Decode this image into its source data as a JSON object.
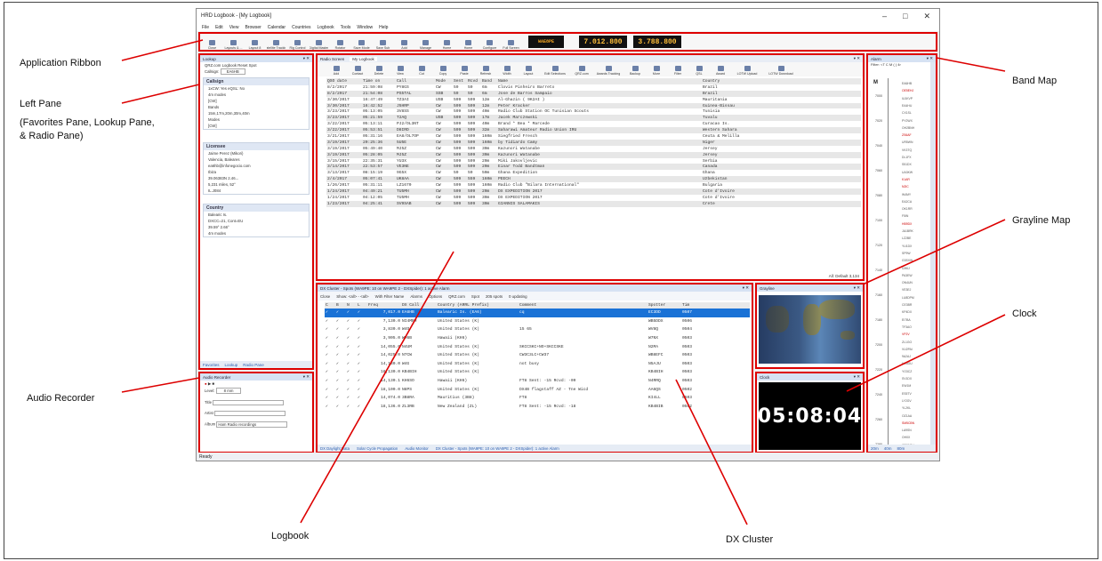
{
  "callouts": {
    "ribbon": "Application Ribbon",
    "left_pane_1": "Left Pane",
    "left_pane_2": "(Favorites Pane, Lookup Pane,",
    "left_pane_3": "& Radio Pane)",
    "audio": "Audio Recorder",
    "logbook": "Logbook",
    "dxcluster": "DX Cluster",
    "clock": "Clock",
    "grayline": "Grayline Map",
    "bandmap": "Band Map"
  },
  "window": {
    "title": "HRD Logbook - [My Logbook]",
    "menu": [
      "File",
      "Edit",
      "View",
      "Browser",
      "Calendar",
      "Countries",
      "Logbook",
      "Tools",
      "Window",
      "Help"
    ]
  },
  "ribbon": {
    "buttons": [
      "Close",
      "Layouts & ...",
      "Layout 8",
      "Satellite Tracking",
      "Rig Control",
      "Digital Master",
      "Rotator",
      "Save Mode",
      "Save Sub",
      "Add",
      "Manage",
      "Home",
      "Home",
      "Configure",
      "Full Screen"
    ],
    "freq_mode": "WAE8PE",
    "freq_vfo_a": "7.012.800",
    "freq_vfo_b": "3.788.800"
  },
  "left_pane": {
    "header": "Lookup",
    "toolbar": "QRZ.com  Logbook  Reset  Spot",
    "callsign_label": "Callsign",
    "callsign_value": "EA6HB",
    "callsign_section": "Callsign",
    "callsign_lines": [
      "1xCW: Yes eQSL: No",
      "4m modes",
      "[CW]",
      "Bands",
      "15m,17m,20m,30m,40m",
      "Modes",
      "[CW]"
    ],
    "licensee_section": "Licensee",
    "licensee_lines": [
      "Jaime Perez (Mikori)",
      "Valencia, Baleares",
      "ea6hb@infonegocio.com",
      "Ibiza",
      "39.06383N 2.46...",
      "5,231 miles, 52°",
      "IL.J084"
    ],
    "country_section": "Country",
    "country_lines": [
      "Balearic Is.",
      "DXCC=21, Cont=EU",
      "39.59° 2.66°",
      "4m modes"
    ],
    "tabs": [
      "Favorites",
      "Lookup",
      "Radio Pane"
    ]
  },
  "audio": {
    "header": "Audio Recorder",
    "level_label": "Level",
    "level_value": "8 mm",
    "title_label": "Title",
    "artist_label": "Artist",
    "album_label": "Album",
    "album_value": "Ham Radio recordings"
  },
  "logbook": {
    "tabs": [
      "Radio Screen",
      "My Logbook"
    ],
    "tools": [
      "Add",
      "Contact",
      "Delete",
      "View",
      "Cut",
      "Copy",
      "Paste",
      "Refresh",
      "Width",
      "Layout",
      "Edit Selections",
      "QRZ.com",
      "Awards Tracking",
      "Backup",
      "More",
      "Filter",
      "QSL",
      "Award",
      "LOTW Upload",
      "LOTW Download"
    ],
    "columns": [
      "QSO date",
      "Time on",
      "Call",
      "Mode",
      "Sent",
      "Rcvd",
      "Band",
      "Name",
      "Country"
    ],
    "rows": [
      [
        "8/2/2017",
        "21:59:08",
        "PY8GS",
        "CW",
        "59",
        "59",
        "6m",
        "Clovis Pinheiro Barreto",
        "Brazil"
      ],
      [
        "8/2/2017",
        "21:54:08",
        "PS5TAL",
        "SSB",
        "59",
        "59",
        "6m",
        "Jose de Barros Sampaio",
        "Brazil"
      ],
      [
        "3/30/2017",
        "16:47:49",
        "TZ3AI",
        "USB",
        "599",
        "599",
        "12m",
        "Al-Ghazin ( 9K2AI )",
        "Mauritania"
      ],
      [
        "3/30/2017",
        "16:42:52",
        "J5HRP",
        "CW",
        "599",
        "599",
        "12m",
        "Peter Kracker",
        "Guinea-Bissau"
      ],
      [
        "3/23/2017",
        "05:13:05",
        "3V8SS",
        "CW",
        "599",
        "599",
        "40m",
        "Radio Club Station OC Tunisian Scouts",
        "Tunisia"
      ],
      [
        "3/23/2017",
        "05:21:59",
        "T2AQ",
        "USB",
        "599",
        "599",
        "17m",
        "Jacek Marczewski",
        "Tuvalu"
      ],
      [
        "3/22/2017",
        "05:13:11",
        "PJ2/OL3NT",
        "CW",
        "599",
        "599",
        "40m",
        "Brand * Bea * Marcede",
        "Curacao Is."
      ],
      [
        "3/22/2017",
        "05:53:51",
        "D8IRD",
        "CW",
        "599",
        "599",
        "32m",
        "Saharawi Amateur Radio Union IRU",
        "Western Sahara"
      ],
      [
        "3/21/2017",
        "05:31:16",
        "EA8/OL7OP",
        "CW",
        "599",
        "599",
        "160m",
        "Siegfried Fresch",
        "Ceuta & Melilla"
      ],
      [
        "3/19/2017",
        "20:25:36",
        "5U5E",
        "CW",
        "599",
        "599",
        "160m",
        "by Tidiardo Camy",
        "Niger"
      ],
      [
        "3/19/2017",
        "05:49:40",
        "MJ5Z",
        "CW",
        "599",
        "599",
        "30m",
        "Kazunori Watanabe",
        "Jersey"
      ],
      [
        "3/19/2017",
        "05:28:05",
        "MJ5Z",
        "CW",
        "599",
        "599",
        "30m",
        "Kazunori Watanabe",
        "Jersey"
      ],
      [
        "3/15/2017",
        "22:35:31",
        "YU3X",
        "CW",
        "599",
        "599",
        "20m",
        "Miki Jakovljevic",
        "Serbia"
      ],
      [
        "3/14/2017",
        "22:53:57",
        "VE3NE",
        "CW",
        "599",
        "599",
        "20m",
        "Einar Todd Bandtman",
        "Canada"
      ],
      [
        "3/13/2017",
        "08:15:19",
        "9G5X",
        "CW",
        "59",
        "59",
        "50m",
        "Ghana Expedition",
        "Ghana"
      ],
      [
        "2/4/2017",
        "05:07:41",
        "UK8AA",
        "CW",
        "599",
        "559",
        "160m",
        "PEECH",
        "Uzbekistan"
      ],
      [
        "1/26/2017",
        "05:31:11",
        "LZ1670",
        "CW",
        "599",
        "599",
        "160m",
        "Radio Club \"Bilara International\"",
        "Bulgaria"
      ],
      [
        "1/24/2017",
        "04:49:21",
        "TU5MH",
        "CW",
        "599",
        "599",
        "20m",
        "DX EXPEDITION 2017",
        "Cote d'Ivoire"
      ],
      [
        "1/24/2017",
        "04:12:05",
        "TU5MH",
        "CW",
        "599",
        "599",
        "30m",
        "DX EXPEDITION 2017",
        "Cote d'Ivoire"
      ],
      [
        "1/23/2017",
        "04:25:41",
        "SV9SAB",
        "CW",
        "599",
        "599",
        "30m",
        "GIANNIS SALAMAKIS",
        "Crete"
      ]
    ],
    "footer": "All: Default   3,134"
  },
  "dxcluster": {
    "header": "DX Cluster - Spots (WA9PE: 10 on WA9PE 2 - DXSpider): 1 active Alarm",
    "toolbar": [
      "Close",
      "Show: <all> - <all>",
      "With Filter Name",
      "Alarms",
      "Options",
      "QRZ.com",
      "Spot",
      "205 spots",
      "0 updating"
    ],
    "columns": [
      "C",
      "B",
      "N",
      "L",
      "Freq",
      "DX Call",
      "Country (ARRL Prefix)",
      "Comment",
      "Spotter",
      "Tim"
    ],
    "rows": [
      [
        "7,017.0",
        "EA6HB",
        "Balearic Is. (EA6)",
        "cq",
        "EC3DD",
        "0507"
      ],
      [
        "7,130.0",
        "NI4MBR",
        "United States (K)",
        "",
        "WB5DDX",
        "0506"
      ],
      [
        "3,830.0",
        "W4O",
        "United States (K)",
        "15 65",
        "WV8Q",
        "0504"
      ],
      [
        "3,905.0",
        "WH6B",
        "Hawaii (KH6)",
        "",
        "W7NX",
        "0503"
      ],
      [
        "14,055.0",
        "N4UM",
        "United States (K)",
        "SKCCSKC+NO+SKCCSKE",
        "N2MA",
        "0503"
      ],
      [
        "14,025.0",
        "N7CW",
        "United States (K)",
        "CW3C3LC+CW37",
        "WB8EFC",
        "0503"
      ],
      [
        "14,130.0",
        "W4G",
        "United States (K)",
        "not busy",
        "N5AJU",
        "0503"
      ],
      [
        "18,130.0",
        "KB4BIH",
        "United States (K)",
        "",
        "KB4BIH",
        "0503"
      ],
      [
        "14,130.1",
        "KH6SO",
        "Hawaii (KH6)",
        "FT8  Sent: -15  Rcvd: -09",
        "N4RRQ",
        "0503"
      ],
      [
        "18,100.0",
        "N8PS",
        "United States (K)",
        "DX4B flagstaff AZ - Tne Wicd",
        "AA6QS",
        "0502"
      ],
      [
        "14,074.0",
        "3B8RA",
        "Mauritius (3B8)",
        "FT8",
        "KI4LL",
        "0503"
      ],
      [
        "18,136.0",
        "ZL3RB",
        "New Zealand (ZL)",
        "FT8  Sent: -15  Rcvd: -18",
        "KB4BIB",
        "0502"
      ]
    ],
    "tabs": [
      "DX Daylight Data",
      "Solar Cycle Propagation",
      "Audio Monitor",
      "DX Cluster - Spots (WA9PE: 10 on WA9PE 2 - DXSpider): 1 active Alarm"
    ]
  },
  "grayline": {
    "header": "Grayline"
  },
  "clock": {
    "header": "Clock",
    "time": "05:08:04"
  },
  "bandmap": {
    "header": "Alarm",
    "filter": "Filter: <T C M ( ) 4r",
    "mode_label": "M",
    "ticks": [
      "7000",
      "7020",
      "7040",
      "7060",
      "7080",
      "7100",
      "7120",
      "7140",
      "7160",
      "7180",
      "7200",
      "7220",
      "7240",
      "7260",
      "7280"
    ],
    "spots": [
      "EA6HB",
      "OE5EHJ",
      "IU1KVP",
      "EA4HU",
      "CX1SL",
      "PY2WX",
      "OH2BNH",
      "ZS6AF",
      "UR5WN",
      "VK3TQ",
      "DL1FX",
      "S51DX",
      "UA3KW",
      "K1AR",
      "N2IC",
      "W4MY",
      "EA2CA",
      "OK1RR",
      "F5IN",
      "HB9DX",
      "JA1BRK",
      "LZ2BE",
      "YU1DX",
      "SP9W",
      "G3SXW",
      "I2WIJ",
      "PA3EW",
      "ON4UN",
      "VE3EJ",
      "LU8DPM",
      "CE3BR",
      "KP4DX",
      "EI7BA",
      "TF3AO",
      "VP2V",
      "ZL1GO",
      "VU2PAI",
      "9A2AJ",
      "HA3OU",
      "YO3CZ",
      "SV1DX",
      "EW1M",
      "ES5TV",
      "LY2GV",
      "YL2KL",
      "OZ1AA",
      "SM5CBN",
      "LA9SN",
      "OH0X",
      "CT1BOH"
    ],
    "red_spots": [
      "OE5EHJ",
      "ZS6AF",
      "K1AR",
      "N2IC",
      "HB9DX",
      "VP2V",
      "SM5CBN"
    ],
    "tabs": [
      "20m",
      "40m",
      "80m"
    ]
  },
  "statusbar": "Ready",
  "colors": {
    "highlight": "#d00000",
    "arrow": "#d00000",
    "selection": "#1a72d6"
  }
}
